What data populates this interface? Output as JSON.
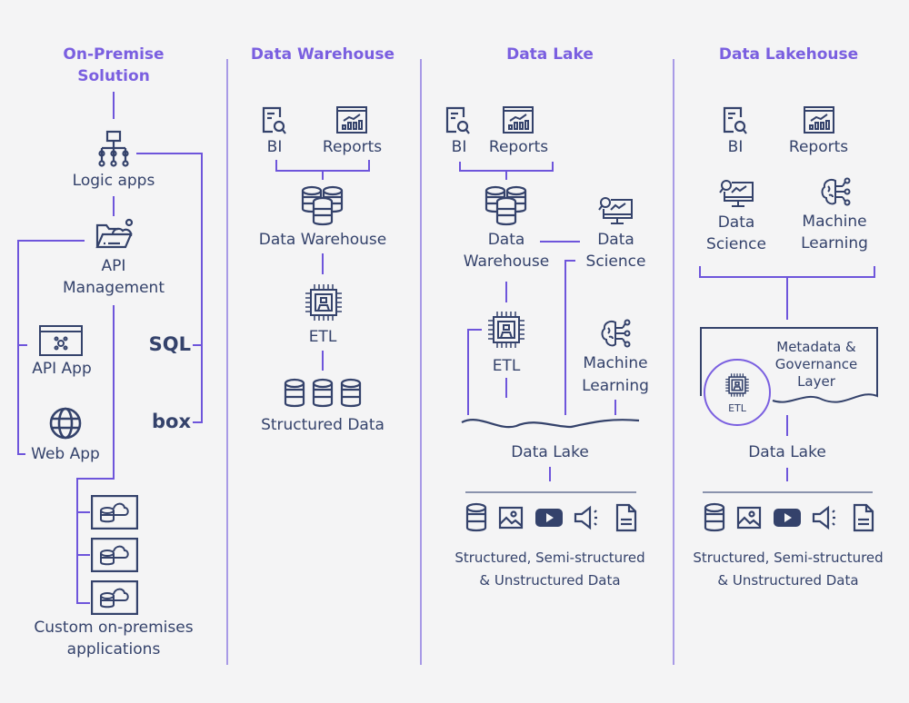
{
  "colors": {
    "accent": "#7a5fe0",
    "ink": "#34426b",
    "divider": "#a89ae6",
    "background": "#f4f4f5"
  },
  "columns": [
    {
      "title": "On-Premise Solution",
      "title_lines": [
        "On-Premise",
        "Solution"
      ],
      "nodes": {
        "logic_apps": "Logic apps",
        "api_management": [
          "API",
          "Management"
        ],
        "api_app": "API App",
        "web_app": "Web App",
        "sql": "SQL",
        "box": "box",
        "custom_apps": [
          "Custom on-premises",
          "applications"
        ]
      }
    },
    {
      "title": "Data Warehouse",
      "nodes": {
        "bi": "BI",
        "reports": "Reports",
        "data_warehouse": "Data Warehouse",
        "etl": "ETL",
        "structured_data": "Structured Data"
      }
    },
    {
      "title": "Data Lake",
      "nodes": {
        "bi": "BI",
        "reports": "Reports",
        "data_warehouse": [
          "Data",
          "Warehouse"
        ],
        "data_science": [
          "Data",
          "Science"
        ],
        "etl": "ETL",
        "machine_learning": [
          "Machine",
          "Learning"
        ],
        "data_lake": "Data Lake",
        "sources": [
          "Structured, Semi-structured",
          "& Unstructured Data"
        ]
      }
    },
    {
      "title": "Data Lakehouse",
      "nodes": {
        "bi": "BI",
        "reports": "Reports",
        "data_science": [
          "Data",
          "Science"
        ],
        "machine_learning": [
          "Machine",
          "Learning"
        ],
        "metadata_layer": [
          "Metadata &",
          "Governance",
          "Layer"
        ],
        "etl": "ETL",
        "data_lake": "Data Lake",
        "sources": [
          "Structured, Semi-structured",
          "& Unstructured Data"
        ]
      }
    }
  ],
  "icons": {
    "bi": "document-search-icon",
    "reports": "chart-window-icon",
    "database_cluster": "database-cluster-icon",
    "etl": "chip-icon",
    "database": "database-icon",
    "data_science": "monitor-analytics-icon",
    "machine_learning": "brain-network-icon",
    "image": "image-icon",
    "video": "video-play-icon",
    "audio": "speaker-icon",
    "document": "document-icon",
    "logic_apps": "hierarchy-icon",
    "api_management": "folder-cloud-icon",
    "api_app": "api-window-icon",
    "web_app": "globe-icon",
    "custom_app": "server-cloud-icon"
  }
}
